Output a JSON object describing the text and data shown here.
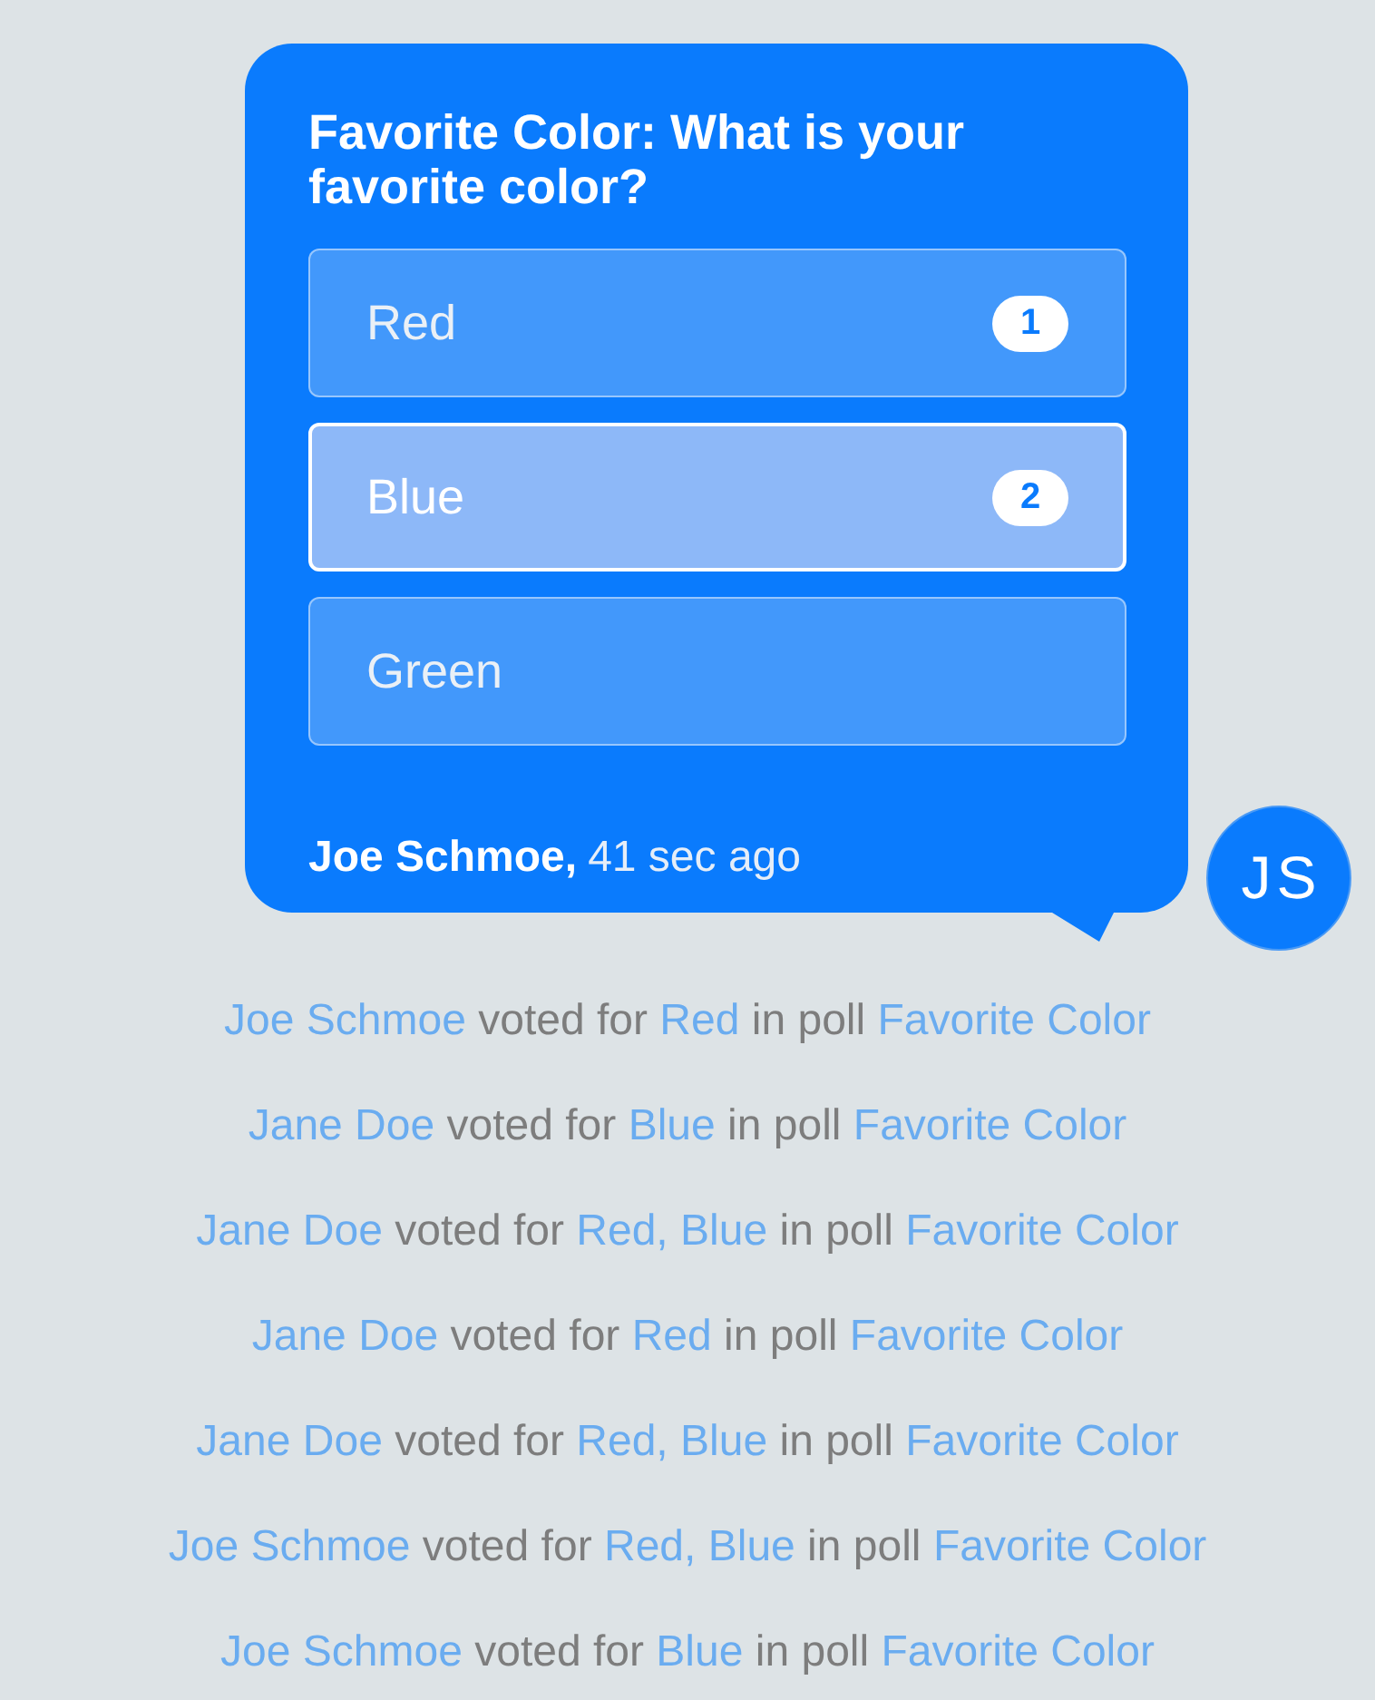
{
  "poll_message": {
    "title": "Favorite Color: What is your favorite color?",
    "options": [
      {
        "label": "Red",
        "count": "1",
        "selected": false
      },
      {
        "label": "Blue",
        "count": "2",
        "selected": true
      },
      {
        "label": "Green",
        "selected": false
      }
    ],
    "sender": "Joe Schmoe,",
    "time": "41 sec ago"
  },
  "avatar": {
    "initials": "JS"
  },
  "activity": [
    {
      "voter": "Joe Schmoe",
      "action": "voted for",
      "choice": "Red",
      "connector": "in poll",
      "poll": "Favorite Color"
    },
    {
      "voter": "Jane Doe",
      "action": "voted for",
      "choice": "Blue",
      "connector": "in poll",
      "poll": "Favorite Color"
    },
    {
      "voter": "Jane Doe",
      "action": "voted for",
      "choice": "Red, Blue",
      "connector": "in poll",
      "poll": "Favorite Color"
    },
    {
      "voter": "Jane Doe",
      "action": "voted for",
      "choice": "Red",
      "connector": "in poll",
      "poll": "Favorite Color"
    },
    {
      "voter": "Jane Doe",
      "action": "voted for",
      "choice": "Red, Blue",
      "connector": "in poll",
      "poll": "Favorite Color"
    },
    {
      "voter": "Joe Schmoe",
      "action": "voted for",
      "choice": "Red, Blue",
      "connector": "in poll",
      "poll": "Favorite Color"
    },
    {
      "voter": "Joe Schmoe",
      "action": "voted for",
      "choice": "Blue",
      "connector": "in poll",
      "poll": "Favorite Color"
    }
  ]
}
